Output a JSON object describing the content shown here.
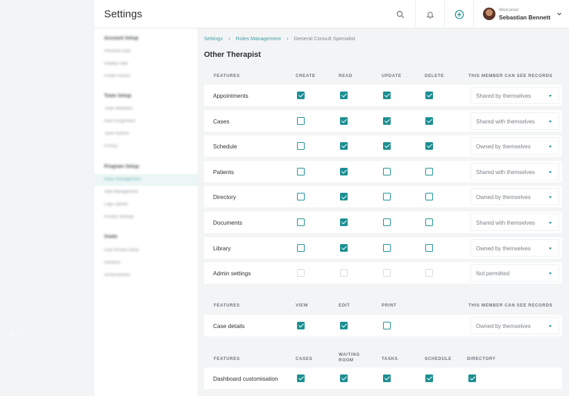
{
  "header": {
    "title": "Settings",
    "welcome": "Welcome!",
    "user_name": "Sebastian Bennett"
  },
  "sidebar": {
    "groups": [
      {
        "label": "Account Setup",
        "items": [
          "Personal Data",
          "Display Data",
          "Profile Picture"
        ]
      },
      {
        "label": "Team Setup",
        "items": [
          "Team Members",
          "Role Assignment",
          "Team Admins",
          "Privacy"
        ]
      },
      {
        "label": "Program Setup",
        "items": [
          "Roles Management",
          "Staff Management",
          "Logo Upload",
          "Privacy Settings"
        ]
      },
      {
        "label": "Goals",
        "items": [
          "Goal Wizard Setup",
          "Rewards",
          "Achievements"
        ]
      }
    ]
  },
  "breadcrumb": {
    "items": [
      "Settings",
      "Roles Management",
      "General Consult Specialist"
    ],
    "separator": "›"
  },
  "section_title": "Other Therapist",
  "permissions": {
    "headers": [
      "FEATURES",
      "CREATE",
      "READ",
      "UPDATE",
      "DELETE",
      "THIS MEMBER CAN SEE RECORDS"
    ],
    "rows": [
      {
        "feature": "Appointments",
        "create": "on",
        "read": "on",
        "update": "on",
        "delete": "on",
        "visibility": "Shared by themselves"
      },
      {
        "feature": "Cases",
        "create": "off",
        "read": "on",
        "update": "on",
        "delete": "on",
        "visibility": "Shared with themselves"
      },
      {
        "feature": "Schedule",
        "create": "off",
        "read": "on",
        "update": "on",
        "delete": "on",
        "visibility": "Owned by themselves"
      },
      {
        "feature": "Patients",
        "create": "off",
        "read": "on",
        "update": "off",
        "delete": "off",
        "visibility": "Shared with themselves"
      },
      {
        "feature": "Directory",
        "create": "off",
        "read": "on",
        "update": "off",
        "delete": "off",
        "visibility": "Owned by themselves"
      },
      {
        "feature": "Documents",
        "create": "off",
        "read": "on",
        "update": "off",
        "delete": "off",
        "visibility": "Shared with themselves"
      },
      {
        "feature": "Library",
        "create": "off",
        "read": "on",
        "update": "off",
        "delete": "off",
        "visibility": "Owned by themselves"
      },
      {
        "feature": "Admin settings",
        "create": "disabled",
        "read": "disabled",
        "update": "disabled",
        "delete": "disabled",
        "visibility": "Not permitted"
      }
    ]
  },
  "case_details": {
    "headers": [
      "FEATURES",
      "VIEW",
      "EDIT",
      "PRINT",
      "THIS MEMBER CAN SEE RECORDS"
    ],
    "row": {
      "feature": "Case details",
      "view": "on",
      "edit": "on",
      "print": "off",
      "visibility": "Owned by themselves"
    }
  },
  "dashboard": {
    "headers": [
      "FEATURES",
      "CASES",
      "WAITING",
      "ROOM",
      "TASKS",
      "SCHEDULE",
      "DIRECTORY"
    ],
    "row": {
      "feature": "Dashboard customisation",
      "cases": "on",
      "waiting_room": "on",
      "tasks": "on",
      "schedule": "on",
      "directory": "on"
    }
  },
  "colors": {
    "accent": "#1b8f93",
    "link": "#3f9ea1"
  },
  "icons": [
    "search-icon",
    "bell-icon",
    "add-circle-icon",
    "chevron-down-icon",
    "dropdown-caret-icon"
  ]
}
